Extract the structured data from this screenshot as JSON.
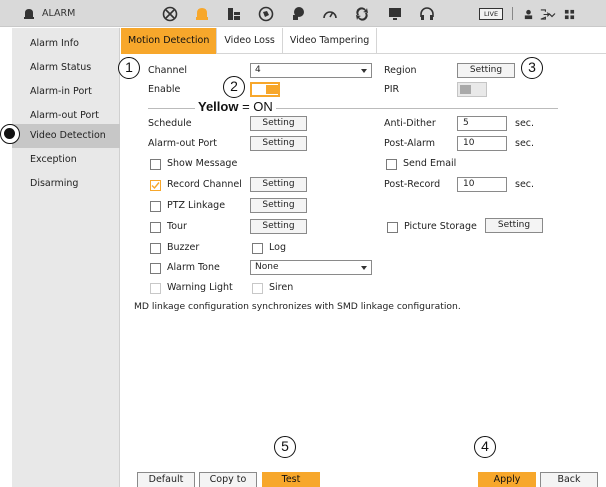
{
  "header": {
    "title": "ALARM",
    "icons": [
      "video-wheel-icon",
      "alarm-bell-icon",
      "storage-icon",
      "network-icon",
      "ptz-camera-icon",
      "performance-gauge-icon",
      "maintenance-icon",
      "display-monitor-icon",
      "audio-headphone-icon"
    ],
    "live_label": "LIVE",
    "active_icon": "alarm-bell-icon",
    "accent_color": "#f7a72b"
  },
  "sidebar": {
    "items": [
      {
        "label": "Alarm Info"
      },
      {
        "label": "Alarm Status"
      },
      {
        "label": "Alarm-in Port"
      },
      {
        "label": "Alarm-out Port"
      },
      {
        "label": "Video Detection"
      },
      {
        "label": "Exception"
      },
      {
        "label": "Disarming"
      }
    ],
    "active": "Video Detection"
  },
  "tabs": [
    {
      "label": "Motion Detection"
    },
    {
      "label": "Video Loss"
    },
    {
      "label": "Video Tampering"
    }
  ],
  "form": {
    "channel_label": "Channel",
    "channel_value": "4",
    "region_label": "Region",
    "region_button": "Setting",
    "enable_label": "Enable",
    "enable_state": "on",
    "pir_label": "PIR",
    "schedule_label": "Schedule",
    "schedule_button": "Setting",
    "antidither_label": "Anti-Dither",
    "antidither_value": "5",
    "antidither_unit": "sec.",
    "alarmout_label": "Alarm-out Port",
    "alarmout_button": "Setting",
    "postalarm_label": "Post-Alarm",
    "postalarm_value": "10",
    "postalarm_unit": "sec.",
    "show_message_label": "Show Message",
    "send_email_label": "Send Email",
    "record_channel_label": "Record Channel",
    "record_channel_button": "Setting",
    "postrecord_label": "Post-Record",
    "postrecord_value": "10",
    "postrecord_unit": "sec.",
    "ptz_linkage_label": "PTZ Linkage",
    "ptz_linkage_button": "Setting",
    "tour_label": "Tour",
    "tour_button": "Setting",
    "picture_storage_label": "Picture Storage",
    "picture_storage_button": "Setting",
    "buzzer_label": "Buzzer",
    "log_label": "Log",
    "alarm_tone_label": "Alarm Tone",
    "alarm_tone_value": "None",
    "warning_light_label": "Warning Light",
    "siren_label": "Siren",
    "note": "MD linkage configuration synchronizes with SMD linkage configuration."
  },
  "annotations": {
    "callout_1": "1",
    "callout_2": "2",
    "callout_3": "3",
    "callout_4": "4",
    "callout_5": "5",
    "yellow_word": "Yellow",
    "yellow_rest": " = ON"
  },
  "footer": {
    "default_button": "Default",
    "copy_button": "Copy to",
    "test_button": "Test",
    "apply_button": "Apply",
    "back_button": "Back"
  }
}
